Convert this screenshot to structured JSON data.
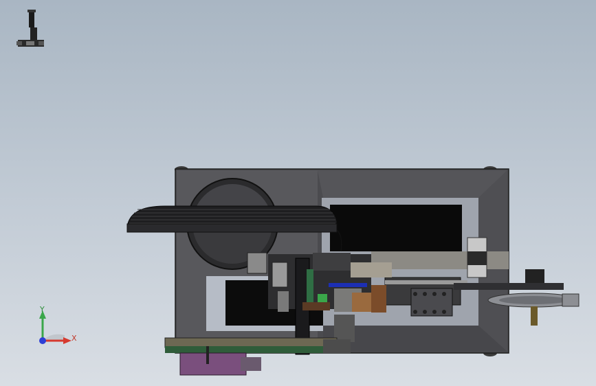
{
  "viewport": {
    "background_top": "#a9b6c3",
    "background_bottom": "#d9dee4"
  },
  "triad": {
    "x_label": "X",
    "y_label": "Y",
    "x_color": "#d63a2f",
    "y_color": "#3aa64a",
    "z_color": "#2d3fd6"
  },
  "view_tool": {
    "icon": "view-orientation-icon"
  }
}
